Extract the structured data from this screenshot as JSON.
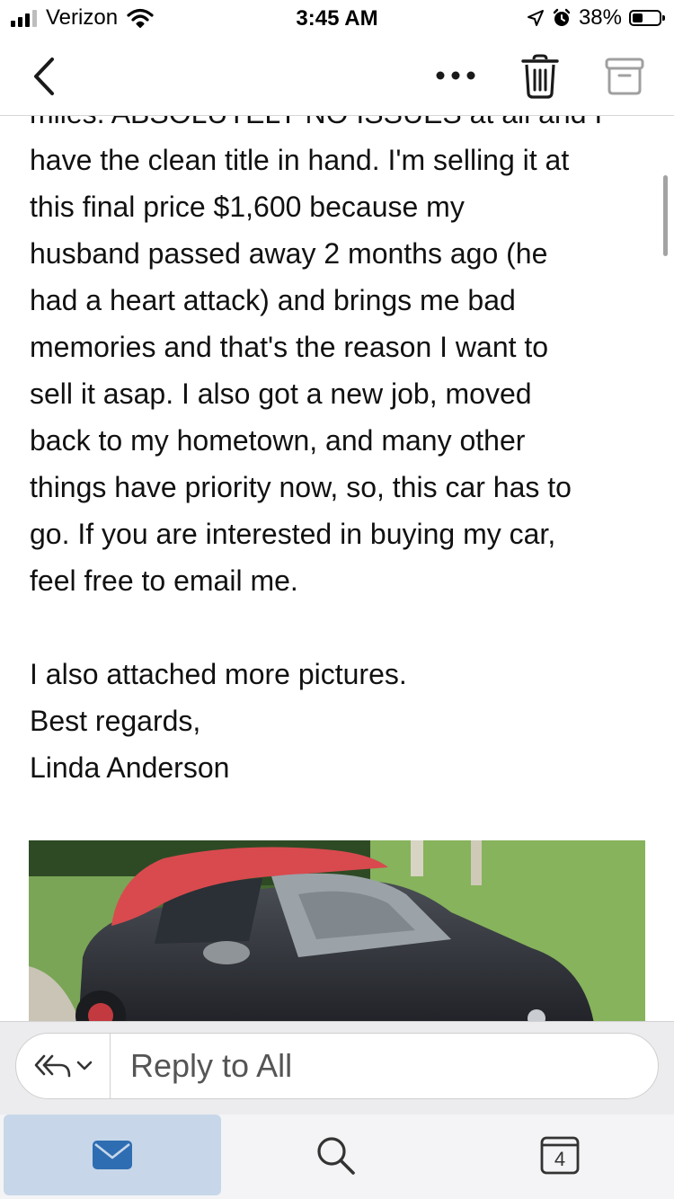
{
  "status_bar": {
    "carrier": "Verizon",
    "time": "3:45 AM",
    "battery_percent": "38%",
    "battery_level": 0.38
  },
  "nav": {
    "back_icon": "chevron-left-icon",
    "more_icon": "more-horizontal-icon",
    "trash_icon": "trash-icon",
    "archive_icon": "archive-icon"
  },
  "email": {
    "partial_top_line": "miles. ABSOLUTELY NO ISSUES at all and I",
    "paragraph_lines": [
      "have the clean title in hand. I'm selling it at",
      "this final price $1,600 because my",
      "husband passed away 2 months ago (he",
      "had a heart attack) and brings me bad",
      "memories and that's the reason I want to",
      "sell it asap. I also got a new job, moved",
      "back to my hometown, and many other",
      "things have priority now, so, this car has to",
      "go. If you are interested in buying my car,",
      "feel free to email me."
    ],
    "attachments_line": "I also attached more pictures.",
    "closing": "Best regards,",
    "signature": "Linda Anderson"
  },
  "reply_bar": {
    "options_icon": "reply-all-icon",
    "placeholder": "Reply to All"
  },
  "tab_bar": {
    "mail_icon": "mail-icon",
    "search_icon": "search-icon",
    "calendar_icon": "calendar-icon",
    "calendar_day": "4",
    "accent_color": "#2f6db3"
  }
}
